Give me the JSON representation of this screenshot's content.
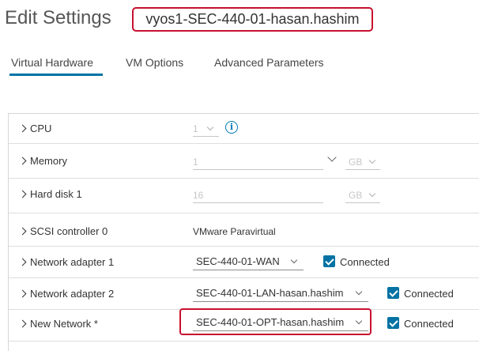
{
  "header": {
    "title": "Edit Settings",
    "vm_name": "vyos1-SEC-440-01-hasan.hashim"
  },
  "tabs": [
    {
      "label": "Virtual Hardware",
      "active": true
    },
    {
      "label": "VM Options",
      "active": false
    },
    {
      "label": "Advanced Parameters",
      "active": false
    }
  ],
  "rows": {
    "cpu": {
      "label": "CPU",
      "value": "1"
    },
    "memory": {
      "label": "Memory",
      "value": "1",
      "unit": "GB"
    },
    "hard_disk": {
      "label": "Hard disk 1",
      "value": "16",
      "unit": "GB"
    },
    "scsi": {
      "label": "SCSI controller 0",
      "value": "VMware Paravirtual"
    },
    "net1": {
      "label": "Network adapter 1",
      "network": "SEC-440-01-WAN",
      "connected_label": "Connected"
    },
    "net2": {
      "label": "Network adapter 2",
      "network": "SEC-440-01-LAN-hasan.hashim",
      "connected_label": "Connected"
    },
    "new_net": {
      "label": "New Network *",
      "network": "SEC-440-01-OPT-hasan.hashim",
      "connected_label": "Connected"
    }
  },
  "colors": {
    "accent": "#0072a3",
    "highlight": "#c8102e"
  }
}
